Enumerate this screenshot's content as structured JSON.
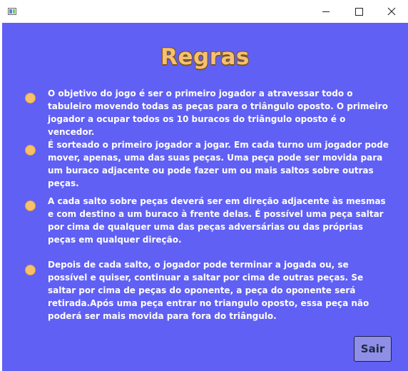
{
  "window": {
    "icon": "app-window-icon",
    "controls": [
      "minimize-icon",
      "maximize-icon",
      "close-icon"
    ]
  },
  "title": "Regras",
  "rules": [
    "O objetivo do jogo é ser o primeiro jogador a atravessar todo o tabuleiro movendo todas as peças para o triângulo oposto. O primeiro jogador a ocupar todos os 10 buracos do triângulo oposto é o vencedor.",
    "É sorteado o primeiro jogador a jogar. Em cada turno um jogador pode mover, apenas, uma das suas peças. Uma peça pode ser movida para um buraco adjacente ou pode fazer um ou mais saltos sobre outras peças.",
    "A cada salto sobre peças deverá ser em direção adjacente às mesmas e com destino a um buraco à frente delas. É possível uma peça saltar por cima de qualquer uma das peças adversárias ou das próprias peças em qualquer direção.",
    "Depois de cada salto, o jogador pode terminar a jogada ou, se possível e quiser, continuar a saltar por cima de outras peças. Se saltar por cima de peças do oponente, a peça do oponente será retirada.Após uma peça entrar no triangulo oposto, essa peça não poderá ser mais movida para fora do triângulo."
  ],
  "exit_label": "Sair",
  "colors": {
    "background": "#6060f4",
    "title": "#f7c070",
    "bullet": "#f7c06a",
    "text": "#ffffff",
    "button": "#8f8fe8"
  }
}
